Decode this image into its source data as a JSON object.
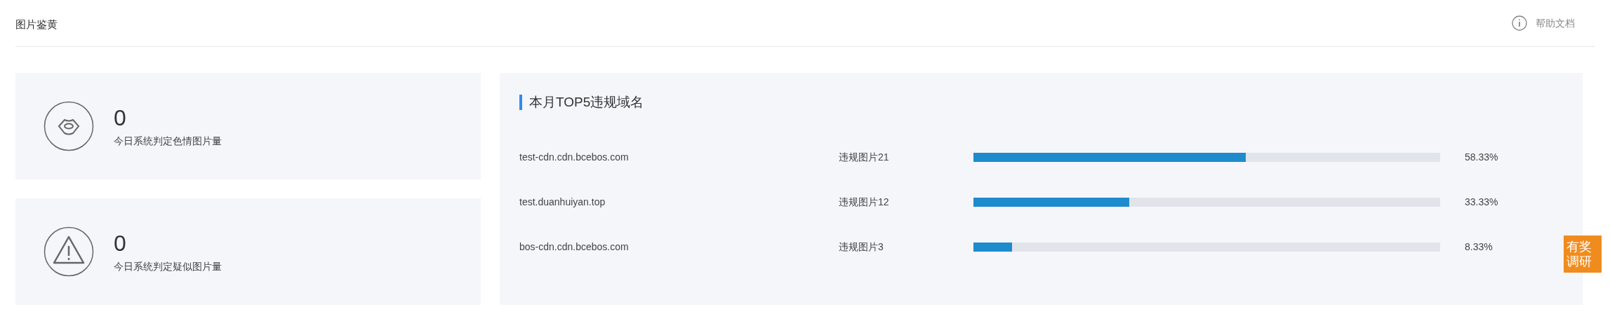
{
  "header": {
    "title": "图片鉴黄",
    "help_link": "帮助文档"
  },
  "stats": [
    {
      "kind": "lips",
      "value": "0",
      "label": "今日系统判定色情图片量"
    },
    {
      "kind": "warning",
      "value": "0",
      "label": "今日系统判定疑似图片量"
    }
  ],
  "top_domains": {
    "title": "本月TOP5违规域名",
    "rows": [
      {
        "domain": "test-cdn.cdn.bcebos.com",
        "count": "违规图片21",
        "level": 0.5833,
        "percent": "58.33%"
      },
      {
        "domain": "test.duanhuiyan.top",
        "count": "违规图片12",
        "level": 0.3333,
        "percent": "33.33%"
      },
      {
        "domain": "bos-cdn.cdn.bcebos.com",
        "count": "违规图片3",
        "level": 0.0833,
        "percent": "8.33%"
      }
    ]
  },
  "survey_badge": {
    "text": "有奖调研"
  }
}
